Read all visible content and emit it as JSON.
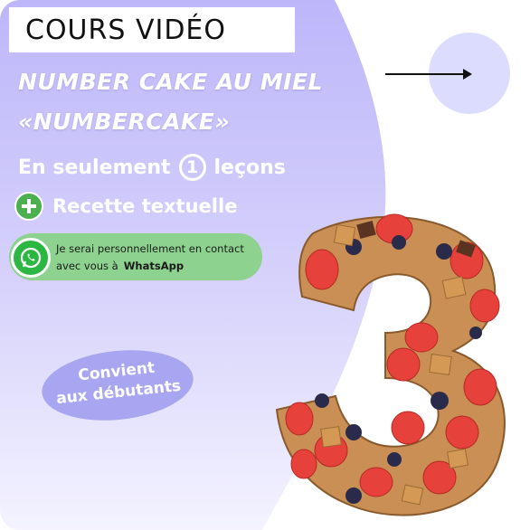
{
  "header": {
    "title": "COURS VIDÉO"
  },
  "headline": {
    "line1": "NUMBER CAKE AU MIEL",
    "line2": "«NUMBERCAKE»"
  },
  "lessons": {
    "prefix": "En seulement",
    "count": "1",
    "suffix": "leçons"
  },
  "recipe": {
    "label": "Recette textuelle"
  },
  "whatsapp": {
    "line1": "Je serai personnellement en contact",
    "line2_prefix": "avec vous à",
    "brand": "WhatsApp"
  },
  "badge": {
    "line1": "Convient",
    "line2": "aux débutants"
  },
  "icons": {
    "plus": "plus-circle-icon",
    "whatsapp": "whatsapp-icon",
    "arrow": "arrow-right-icon"
  },
  "colors": {
    "lavender": "#c9c4fb",
    "green": "#8dd38f",
    "whatsapp_green": "#2bb741",
    "badge": "#a8a6f0"
  }
}
